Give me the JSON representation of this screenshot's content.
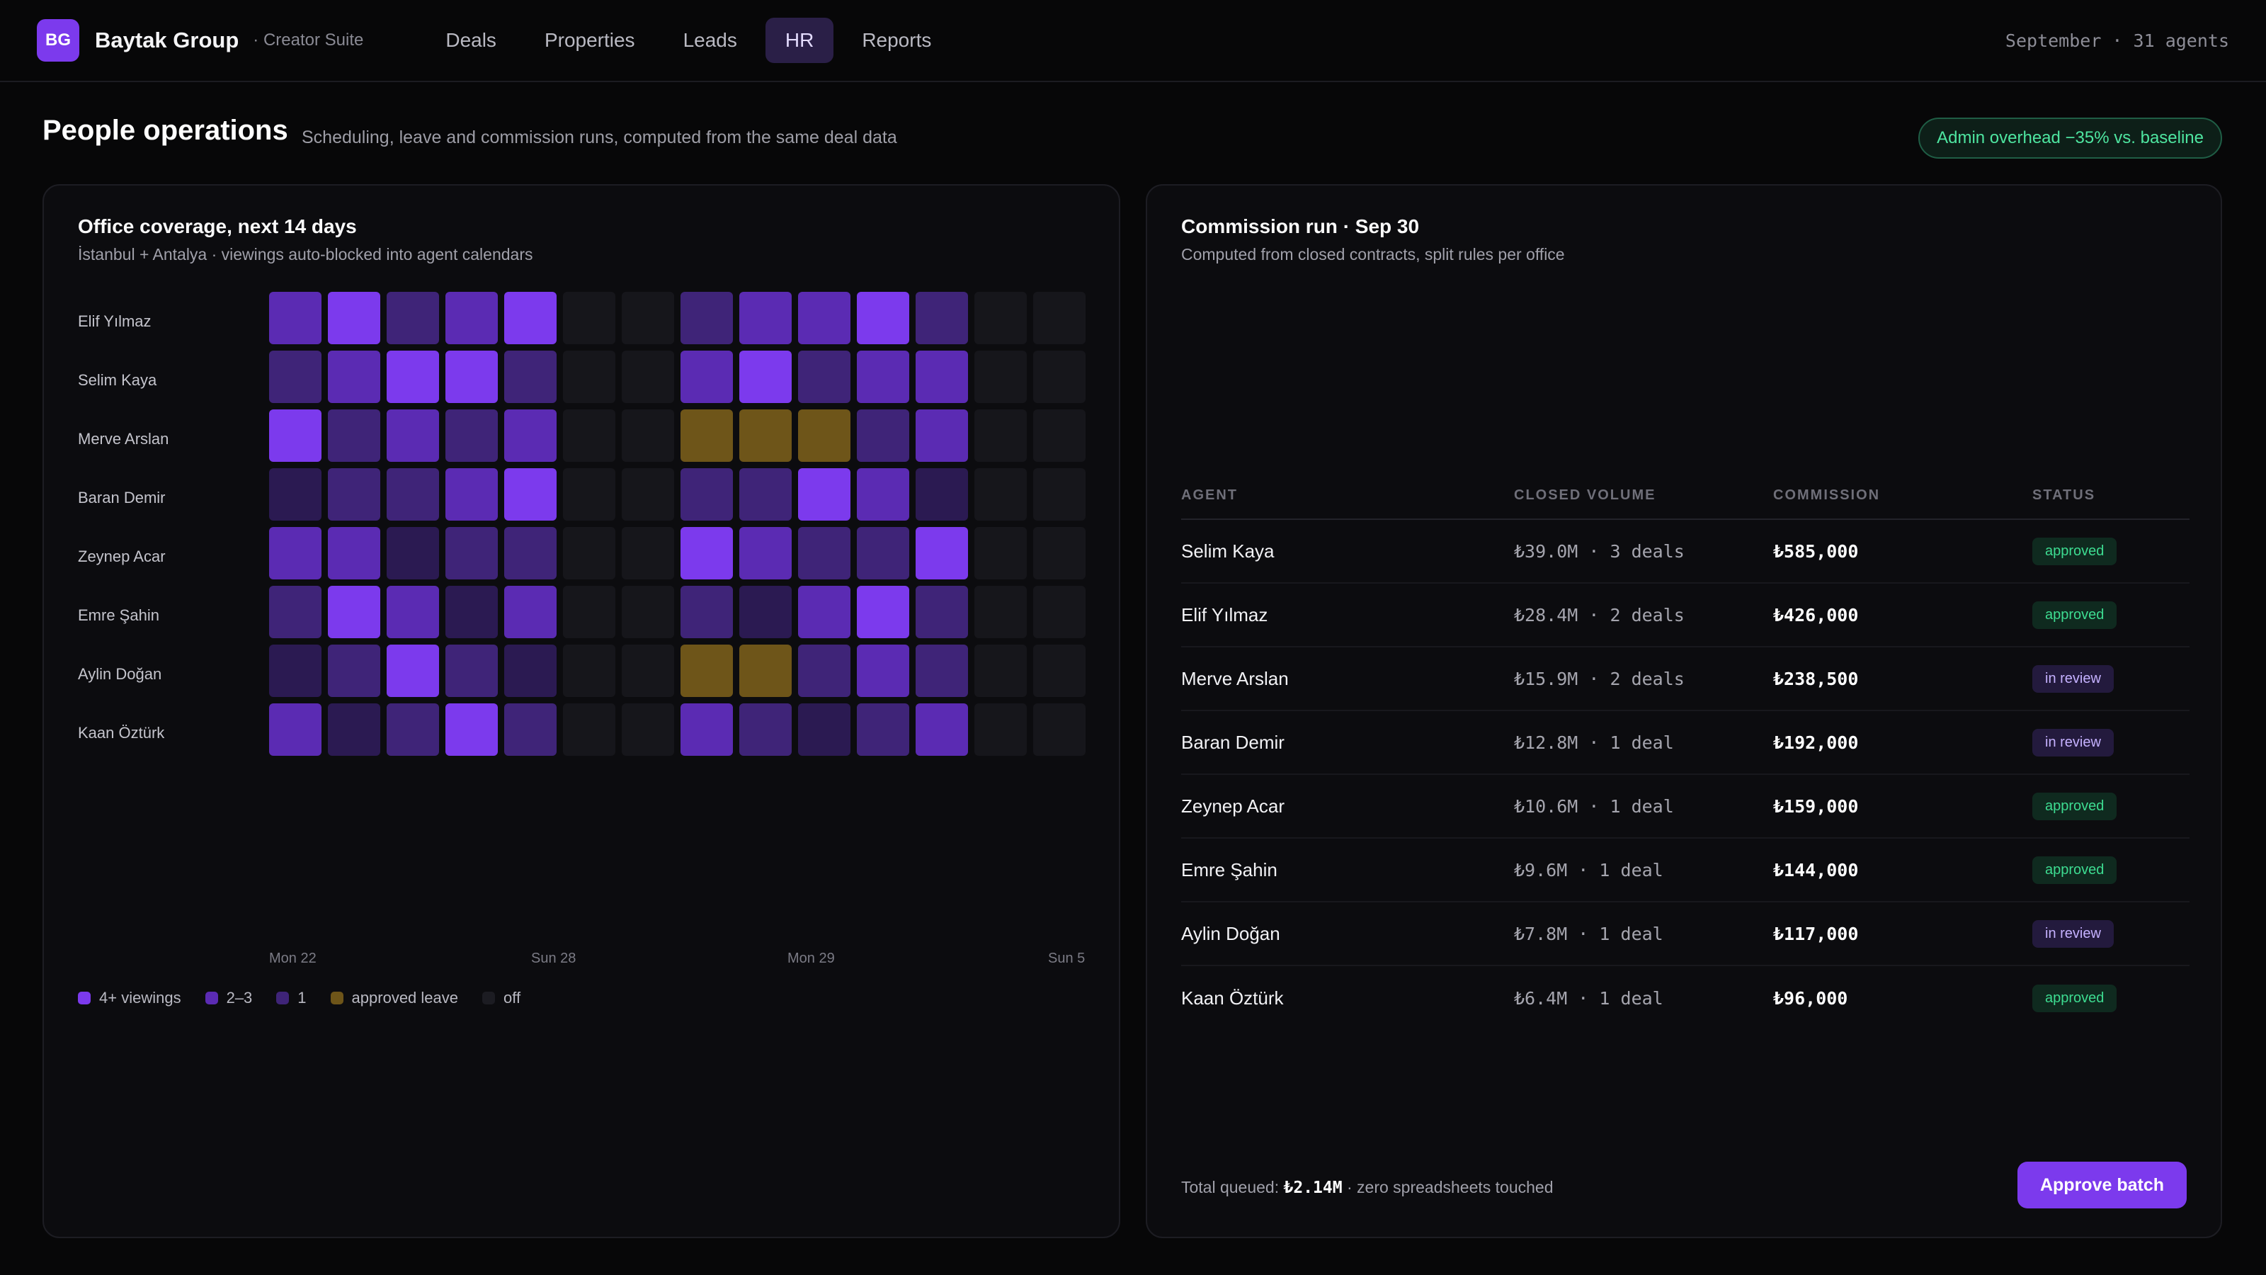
{
  "app": {
    "logo_initials": "BG",
    "brand": "Baytak Group",
    "brand_sub": "· Creator Suite",
    "nav": [
      "Deals",
      "Properties",
      "Leads",
      "HR",
      "Reports"
    ],
    "active_nav": "HR",
    "context": "September · 31 agents"
  },
  "header": {
    "title": "People operations",
    "subtitle": "Scheduling, leave and commission runs, computed from the same deal data",
    "pill": "Admin overhead −35% vs. baseline"
  },
  "coverage": {
    "title": "Office coverage, next 14 days",
    "subtitle": "İstanbul + Antalya · viewings auto-blocked into agent calendars",
    "agents": [
      {
        "name": "Elif Yılmaz",
        "days": [
          "l3",
          "l4",
          "l2",
          "l3",
          "l4",
          "off",
          "off",
          "l2",
          "l3",
          "l3",
          "l4",
          "l2",
          "off",
          "off"
        ]
      },
      {
        "name": "Selim Kaya",
        "days": [
          "l2",
          "l3",
          "l4",
          "l4",
          "l2",
          "off",
          "off",
          "l3",
          "l4",
          "l2",
          "l3",
          "l3",
          "off",
          "off"
        ]
      },
      {
        "name": "Merve Arslan",
        "days": [
          "l4",
          "l2",
          "l3",
          "l2",
          "l3",
          "off",
          "off",
          "leave",
          "leave",
          "leave",
          "l2",
          "l3",
          "off",
          "off"
        ]
      },
      {
        "name": "Baran Demir",
        "days": [
          "l1",
          "l2",
          "l2",
          "l3",
          "l4",
          "off",
          "off",
          "l2",
          "l2",
          "l4",
          "l3",
          "l1",
          "off",
          "off"
        ]
      },
      {
        "name": "Zeynep Acar",
        "days": [
          "l3",
          "l3",
          "l1",
          "l2",
          "l2",
          "off",
          "off",
          "l4",
          "l3",
          "l2",
          "l2",
          "l4",
          "off",
          "off"
        ]
      },
      {
        "name": "Emre Şahin",
        "days": [
          "l2",
          "l4",
          "l3",
          "l1",
          "l3",
          "off",
          "off",
          "l2",
          "l1",
          "l3",
          "l4",
          "l2",
          "off",
          "off"
        ]
      },
      {
        "name": "Aylin Doğan",
        "days": [
          "l1",
          "l2",
          "l4",
          "l2",
          "l1",
          "off",
          "off",
          "leave",
          "leave",
          "l2",
          "l3",
          "l2",
          "off",
          "off"
        ]
      },
      {
        "name": "Kaan Öztürk",
        "days": [
          "l3",
          "l1",
          "l2",
          "l4",
          "l2",
          "off",
          "off",
          "l3",
          "l2",
          "l1",
          "l2",
          "l3",
          "off",
          "off"
        ]
      }
    ],
    "axis_labels": [
      "Mon 22",
      "Sun 28",
      "Mon 29",
      "Sun 5"
    ],
    "legend": [
      {
        "key": "l4",
        "label": "4+ viewings",
        "color": "#7c3aed"
      },
      {
        "key": "l3",
        "label": "2–3",
        "color": "#5b2bb3"
      },
      {
        "key": "l2",
        "label": "1",
        "color": "#3f2478"
      },
      {
        "key": "leave",
        "label": "approved leave",
        "color": "#6e5519"
      },
      {
        "key": "off",
        "label": "off",
        "color": "#1c1c22"
      }
    ]
  },
  "commission": {
    "title": "Commission run · Sep 30",
    "subtitle": "Computed from closed contracts, split rules per office",
    "columns": [
      "AGENT",
      "CLOSED VOLUME",
      "COMMISSION",
      "STATUS"
    ],
    "rows": [
      {
        "agent": "Selim Kaya",
        "volume": "₺39.0M · 3 deals",
        "commission": "₺585,000",
        "status": "approved"
      },
      {
        "agent": "Elif Yılmaz",
        "volume": "₺28.4M · 2 deals",
        "commission": "₺426,000",
        "status": "approved"
      },
      {
        "agent": "Merve Arslan",
        "volume": "₺15.9M · 2 deals",
        "commission": "₺238,500",
        "status": "in review"
      },
      {
        "agent": "Baran Demir",
        "volume": "₺12.8M · 1 deal",
        "commission": "₺192,000",
        "status": "in review"
      },
      {
        "agent": "Zeynep Acar",
        "volume": "₺10.6M · 1 deal",
        "commission": "₺159,000",
        "status": "approved"
      },
      {
        "agent": "Emre Şahin",
        "volume": "₺9.6M · 1 deal",
        "commission": "₺144,000",
        "status": "approved"
      },
      {
        "agent": "Aylin Doğan",
        "volume": "₺7.8M · 1 deal",
        "commission": "₺117,000",
        "status": "in review"
      },
      {
        "agent": "Kaan Öztürk",
        "volume": "₺6.4M · 1 deal",
        "commission": "₺96,000",
        "status": "approved"
      }
    ],
    "footer_prefix": "Total queued: ",
    "footer_total": "₺2.14M",
    "footer_suffix": " · zero spreadsheets touched",
    "approve_label": "Approve batch"
  }
}
